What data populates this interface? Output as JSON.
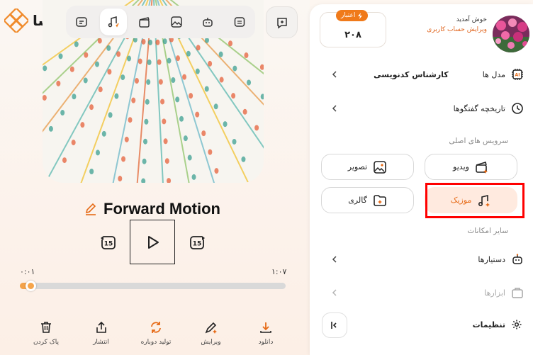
{
  "logo": {
    "text": "هوشا"
  },
  "toolbar": {
    "items": [
      "chat-icon",
      "file-icon",
      "music-icon",
      "video-icon",
      "image-icon",
      "robot-icon"
    ],
    "active": "music-icon"
  },
  "player": {
    "title": "Forward Motion",
    "time_current": "۰:۰۱",
    "time_total": "۱:۰۷",
    "progress": 0.02,
    "skip_back_label": "15",
    "skip_forward_label": "15"
  },
  "actions": [
    {
      "label": "دانلود",
      "icon": "download-icon"
    },
    {
      "label": "ویرایش",
      "icon": "magic-pen-icon"
    },
    {
      "label": "تولید دوباره",
      "icon": "refresh-icon"
    },
    {
      "label": "انتشار",
      "icon": "share-icon"
    },
    {
      "label": "پاک کردن",
      "icon": "trash-icon"
    }
  ],
  "account": {
    "credit_label": "اعتبار",
    "credit_value": "۲۰۸",
    "welcome": "خوش آمدید",
    "edit_profile": "ویرایش حساب کاربری"
  },
  "menu": {
    "models_label": "مدل ها",
    "models_value": "کارشناس کدنویسی",
    "history_label": "تاریخچه گفتگوها",
    "main_services_title": "سرویس های اصلی",
    "services": {
      "video": "ویدیو",
      "image": "تصویر",
      "music": "موزیک",
      "gallery": "گالری"
    },
    "other_title": "سایر امکانات",
    "assistants": "دستیارها",
    "tools": "ابزارها",
    "settings": "تنظیمات"
  },
  "colors": {
    "accent": "#f07a1a",
    "music_bg": "#ffeadf",
    "highlight": "#ff0000"
  }
}
